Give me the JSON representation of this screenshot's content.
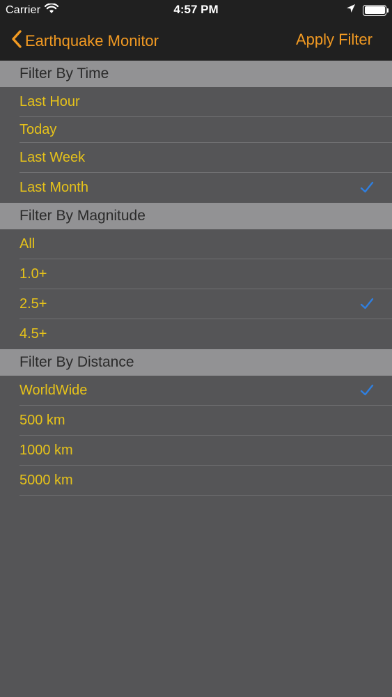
{
  "status_bar": {
    "carrier": "Carrier",
    "time": "4:57 PM"
  },
  "nav": {
    "back_label": "Earthquake Monitor",
    "apply_label": "Apply Filter"
  },
  "colors": {
    "accent": "#f29a22",
    "item_text": "#e6c21a",
    "check": "#2f7fe0",
    "background": "#555557",
    "header_bg": "#929294"
  },
  "sections": [
    {
      "title": "Filter By Time",
      "items": [
        {
          "label": "Last Hour",
          "selected": false
        },
        {
          "label": "Today",
          "selected": false
        },
        {
          "label": "Last Week",
          "selected": false
        },
        {
          "label": "Last Month",
          "selected": true
        }
      ]
    },
    {
      "title": "Filter By Magnitude",
      "items": [
        {
          "label": "All",
          "selected": false
        },
        {
          "label": "1.0+",
          "selected": false
        },
        {
          "label": "2.5+",
          "selected": true
        },
        {
          "label": "4.5+",
          "selected": false
        }
      ]
    },
    {
      "title": "Filter By Distance",
      "items": [
        {
          "label": "WorldWide",
          "selected": true
        },
        {
          "label": "500 km",
          "selected": false
        },
        {
          "label": "1000 km",
          "selected": false
        },
        {
          "label": "5000 km",
          "selected": false
        }
      ]
    }
  ]
}
